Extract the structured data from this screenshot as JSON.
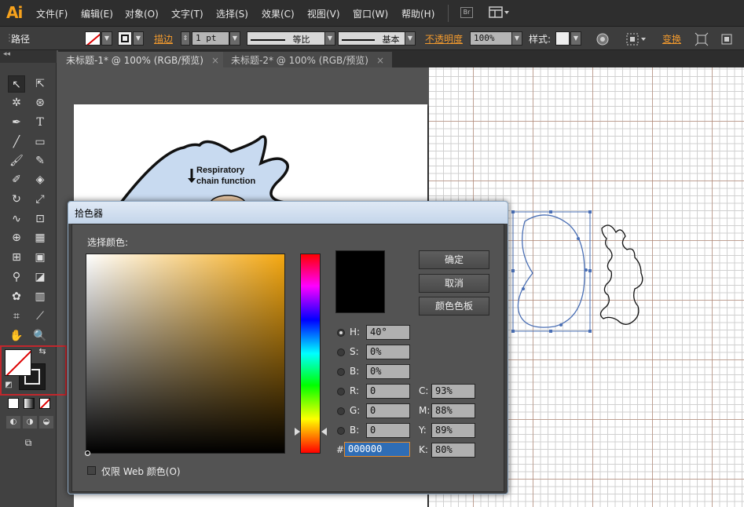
{
  "app": {
    "logo": "Ai"
  },
  "menu": [
    "文件(F)",
    "编辑(E)",
    "对象(O)",
    "文字(T)",
    "选择(S)",
    "效果(C)",
    "视图(V)",
    "窗口(W)",
    "帮助(H)"
  ],
  "menu_extra": {
    "bridge": "Br"
  },
  "control_bar": {
    "selection_type": "路径",
    "stroke_label": "描边",
    "stroke_weight": "1 pt",
    "profile_value": "等比",
    "brush_value": "基本",
    "opacity_label": "不透明度",
    "opacity_value": "100%",
    "style_label": "样式:",
    "transform_label": "变换"
  },
  "tabs": [
    {
      "label": "未标题-1* @ 100% (RGB/预览)",
      "close": "×"
    },
    {
      "label": "未标题-2* @ 100% (RGB/预览)",
      "close": "×"
    }
  ],
  "artwork_text": {
    "line1": "Respiratory",
    "line2": "chain function"
  },
  "dialog": {
    "title": "拾色器",
    "pick_label": "选择颜色:",
    "ok": "确定",
    "cancel": "取消",
    "swatches": "颜色色板",
    "web_only": "仅限 Web 颜色(O)",
    "fields": {
      "H": {
        "label": "H:",
        "value": "40°"
      },
      "S": {
        "label": "S:",
        "value": "0%"
      },
      "Bv": {
        "label": "B:",
        "value": "0%"
      },
      "R": {
        "label": "R:",
        "value": "0"
      },
      "G": {
        "label": "G:",
        "value": "0"
      },
      "B": {
        "label": "B:",
        "value": "0"
      },
      "C": {
        "label": "C:",
        "value": "93%"
      },
      "M": {
        "label": "M:",
        "value": "88%"
      },
      "Y": {
        "label": "Y:",
        "value": "89%"
      },
      "K": {
        "label": "K:",
        "value": "80%"
      },
      "hex": {
        "label": "#",
        "value": "000000"
      }
    },
    "selected_color": "#000000",
    "hue_gradient_end": "#f5a811"
  },
  "colors": {
    "accent": "#f7a21c",
    "highlight_border": "#c1272d",
    "selection_blue": "#4a6fb5"
  }
}
